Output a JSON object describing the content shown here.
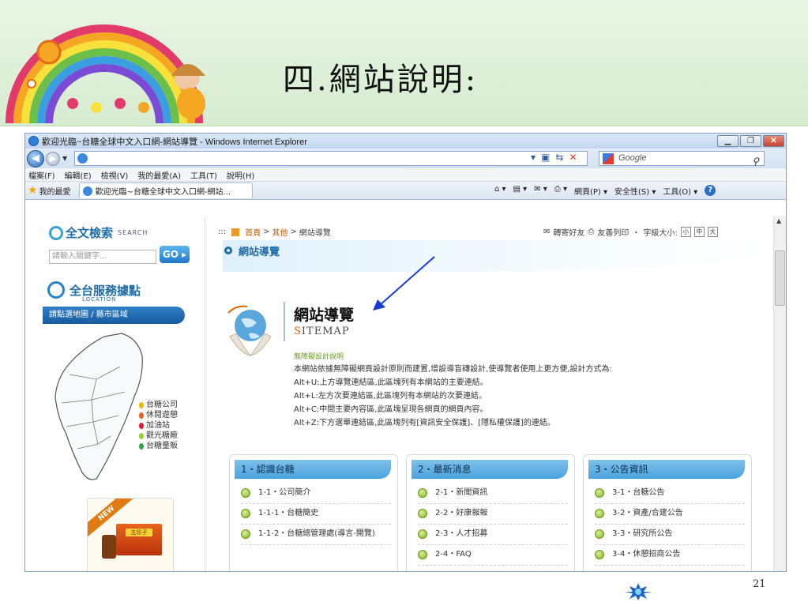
{
  "slide": {
    "title": "四.網站說明:",
    "page_number": "21"
  },
  "browser": {
    "window_title": "歡迎光臨~台糖全球中文入口網-網站導覽 - Windows Internet Explorer",
    "search_placeholder": "Google",
    "menu": [
      "檔案(F)",
      "編輯(E)",
      "檢視(V)",
      "我的最愛(A)",
      "工具(T)",
      "說明(H)"
    ],
    "favorites_label": "我的最愛",
    "tab_label": "歡迎光臨~台糖全球中文入口網-網站...",
    "commands": [
      "網頁(P) ▾",
      "安全性(S) ▾",
      "工具(O) ▾"
    ]
  },
  "sidebar": {
    "search_title": "全文檢索",
    "search_subtitle": "SEARCH",
    "search_placeholder": "請輸入關鍵字...",
    "go_label": "GO",
    "service_title": "全台服務據點",
    "service_subtitle": "LOCATION",
    "region_label": "請點選地圖 / 縣市區域",
    "legend": [
      {
        "label": "台糖公司",
        "color": "#f0b400"
      },
      {
        "label": "休閒遊憩",
        "color": "#e8621a"
      },
      {
        "label": "加油站",
        "color": "#d81e3a"
      },
      {
        "label": "觀光糖廠",
        "color": "#9acd32"
      },
      {
        "label": "台糖量販",
        "color": "#2aa84a"
      }
    ],
    "promo_badge": "NEW",
    "promo_product": "五珍子"
  },
  "main": {
    "breadcrumb_prefix": ":::",
    "breadcrumb_home": "首頁",
    "breadcrumb_other": "其他",
    "breadcrumb_current": "網站導覽",
    "tools_forward": "轉寄好友",
    "tools_print": "友善列印",
    "tools_fontsize": "字級大小:",
    "fontsize_small": "小",
    "fontsize_medium": "中",
    "fontsize_large": "大",
    "section_title": "網站導覽",
    "sitemap_title": "網站導覽",
    "sitemap_sub_first": "S",
    "sitemap_sub_rest": "ITEMAP",
    "accessibility_head": "無障礙設計說明",
    "description": [
      "本網站依據無障礙網頁設計原則而建置,增設導盲磚設計,使導覽者使用上更方便,設計方式為:",
      "Alt+U:上方導覽連結區,此區塊列有本網站的主要連結。",
      "Alt+L:左方次要連結區,此區塊列有本網站的次要連結。",
      "Alt+C:中間主要內容區,此區塊呈現各網頁的網頁內容。",
      "Alt+Z:下方選單連結區,此區塊列有[資訊安全保護]、[隱私權保護]的連結。"
    ],
    "categories": [
      {
        "title": "1・認識台糖",
        "items": [
          "1-1・公司簡介",
          "1-1-1・台糖簡史",
          "1-1-2・台糖總管理處(導言-開覽)"
        ]
      },
      {
        "title": "2・最新消息",
        "items": [
          "2-1・新聞資訊",
          "2-2・好康報報",
          "2-3・人才招募",
          "2-4・FAQ"
        ]
      },
      {
        "title": "3・公告資訊",
        "items": [
          "3-1・台糖公告",
          "3-2・資產/合建公告",
          "3-3・研究所公告",
          "3-4・休憩招商公告"
        ]
      }
    ]
  },
  "colors": {
    "accent": "#1e6ca8",
    "link_orange": "#c25b00",
    "arrow": "#1a3ad6"
  }
}
